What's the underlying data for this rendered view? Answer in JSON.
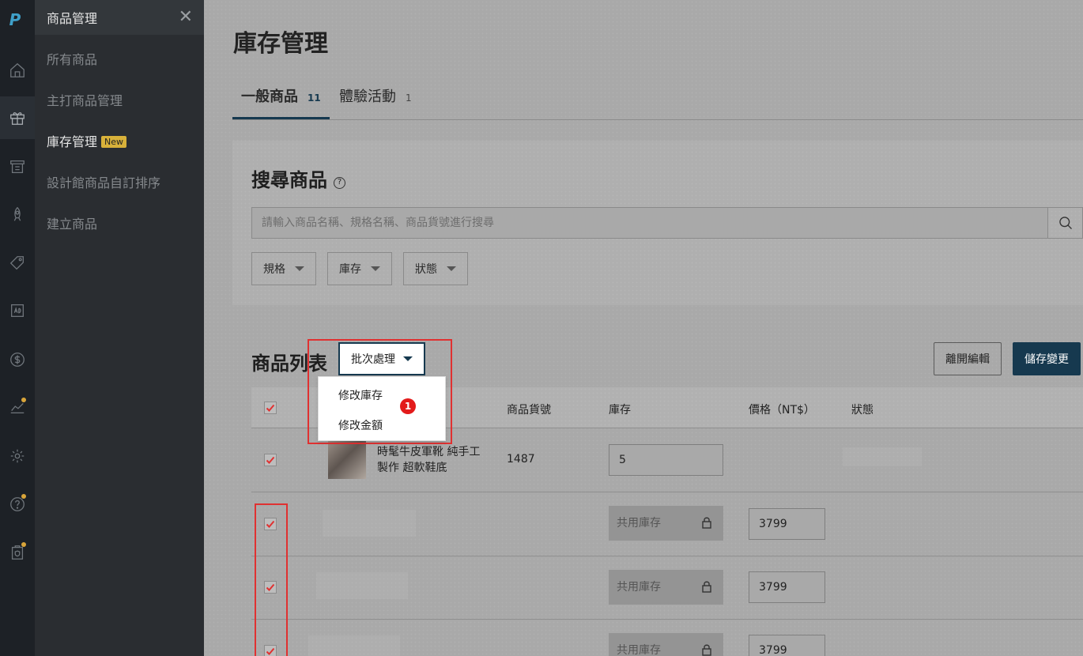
{
  "rail": {
    "logo": "P",
    "icons": [
      "home-icon",
      "gift-icon",
      "receipt-icon",
      "rocket-icon",
      "tag-icon",
      "ad-icon",
      "dollar-icon",
      "chart-icon",
      "gear-icon",
      "help-icon",
      "shield-icon"
    ]
  },
  "subnav": {
    "title": "商品管理",
    "close": "✕",
    "items": [
      {
        "label": "所有商品"
      },
      {
        "label": "主打商品管理"
      },
      {
        "label": "庫存管理",
        "badge": "New"
      },
      {
        "label": "設計館商品自訂排序"
      },
      {
        "label": "建立商品"
      }
    ]
  },
  "page": {
    "title": "庫存管理"
  },
  "tabs": [
    {
      "label": "一般商品",
      "count": "11"
    },
    {
      "label": "體驗活動",
      "count": "1"
    }
  ],
  "search": {
    "title": "搜尋商品",
    "help": "?",
    "placeholder": "請輸入商品名稱、規格名稱、商品貨號進行搜尋",
    "filters": [
      "規格",
      "庫存",
      "狀態"
    ]
  },
  "list": {
    "title": "商品列表",
    "batch_label": "批次處理",
    "batch_options": [
      "修改庫存",
      "修改金額"
    ],
    "step_marker": "1",
    "leave_label": "離開編輯",
    "save_label": "儲存變更",
    "headers": {
      "sku": "商品貨號",
      "stock": "庫存",
      "price": "價格（NT$）",
      "status": "狀態"
    },
    "product": {
      "name_line1": "時髦牛皮軍靴 純手工",
      "name_line2": "製作 超軟鞋底",
      "sku": "1487",
      "stock": "5"
    },
    "variants": [
      {
        "stock": "共用庫存",
        "price": "3799"
      },
      {
        "stock": "共用庫存",
        "price": "3799"
      },
      {
        "stock": "共用庫存",
        "price": "3799"
      }
    ]
  },
  "colors": {
    "accent": "#16394f",
    "highlight": "#e03131",
    "badge": "#d8b13a"
  }
}
